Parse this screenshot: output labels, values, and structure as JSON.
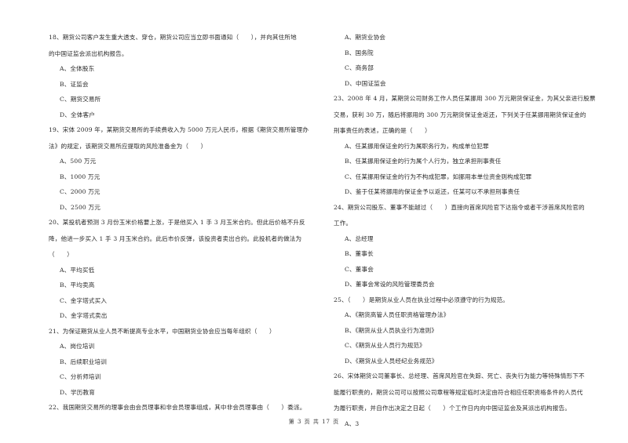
{
  "document": {
    "footer": "第 3 页 共 17 页",
    "left_column": [
      {
        "number": "18",
        "stem_lines": [
          "18、期货公司客户发生重大透支、穿仓，期货公司应当立即书面通知（　　），并向其住所地",
          "的中国证监会派出机构报告。"
        ],
        "options": [
          "A、全体股东",
          "B、证监会",
          "C、期货交易所",
          "D、全体客户"
        ]
      },
      {
        "number": "19",
        "stem_lines": [
          "19、宋体 2009 年，某期货交易所的手续费收入为 5000 万元人民币，根据《期货交易所管理办",
          "法》的规定，该期货交易所应提取的风险准备金为（　　）"
        ],
        "options": [
          "A、500 万元",
          "B、1000 万元",
          "C、2000 万元",
          "D、2500 万元"
        ]
      },
      {
        "number": "20",
        "stem_lines": [
          "20、某投机者预测 3 月份玉米价格要上涨，于是他买入 1 手 3 月玉米合约。但此后价格不升反",
          "降，他进一步买入 1 手 3 月玉米合约。此后市价反弹，该投资者卖出合约。此投机者的做法为",
          "（　　）"
        ],
        "options": [
          "A、平均买低",
          "B、平均卖高",
          "C、金字塔式买入",
          "D、金字塔式卖出"
        ]
      },
      {
        "number": "21",
        "stem_lines": [
          "21、为保证期货从业人员不断提高专业水平，中国期货业协会应当每年组织（　　）"
        ],
        "options": [
          "A、岗位培训",
          "B、后续职业培训",
          "C、分析师培训",
          "D、学历教育"
        ]
      },
      {
        "number": "22",
        "stem_lines": [
          "22、我国期货交易所的理事会由会员理事和非会员理事组成，其中非会员理事由（　　）委派。"
        ],
        "options": []
      }
    ],
    "right_column": [
      {
        "number": "22-cont",
        "stem_lines": [],
        "options": [
          "A、期货业协会",
          "B、国务院",
          "C、商务部",
          "D、中国证监会"
        ]
      },
      {
        "number": "23",
        "stem_lines": [
          "23、2008 年 4 月，某期货公司财务工作人员任某挪用 300 万元期货保证金，为其父亲进行股票",
          "交易，获利 30 万，随后将挪用的 300 万元期货保证金返还，下列关于任某挪用期货保证金的",
          "刑事责任的表述，正确的是（　　）"
        ],
        "options": [
          "A、任某挪用保证金的行为属职务行为，构成单位犯罪",
          "B、任某挪用保证金的行为属个人行为，独立承担刑事责任",
          "C、任某挪用保证金的行为不构成犯罪，如挪用本单位资金则构成犯罪",
          "D、鉴于任某将挪用的保证金予以返还，任某可以不承担刑事责任"
        ]
      },
      {
        "number": "24",
        "stem_lines": [
          "24、期货公司股东、董事不能越过（　　）直接向首席风险官下达指令或者干涉首席风险官的",
          "工作。"
        ],
        "options": [
          "A、总经理",
          "B、董事长",
          "C、董事会",
          "D、董事会常设的风险管理委员会"
        ]
      },
      {
        "number": "25",
        "stem_lines": [
          "25、（　　）是期货从业人员在执业过程中必须遵守的行为规范。"
        ],
        "options": [
          "A、《期货高管人员任职资格管理办法》",
          "B、《期货从业人员执业行为准则》",
          "C、《期货从业人员行为规范》",
          "D、《期货从业人员经纪业务规范》"
        ]
      },
      {
        "number": "26",
        "stem_lines": [
          "26、宋体期货公司董事长、总经理、首席风险官在失踪、死亡、丧失行为能力等特殊情形下不",
          "能履行职责的，期货公司可以按照公司章程等规定临时决定由符合相应任职资格条件的人员代",
          "为履行职责，并自作出决定之日起（　　）个工作日内向中国证监会及其派出机构报告。"
        ],
        "options": [
          "A、3"
        ]
      }
    ]
  }
}
